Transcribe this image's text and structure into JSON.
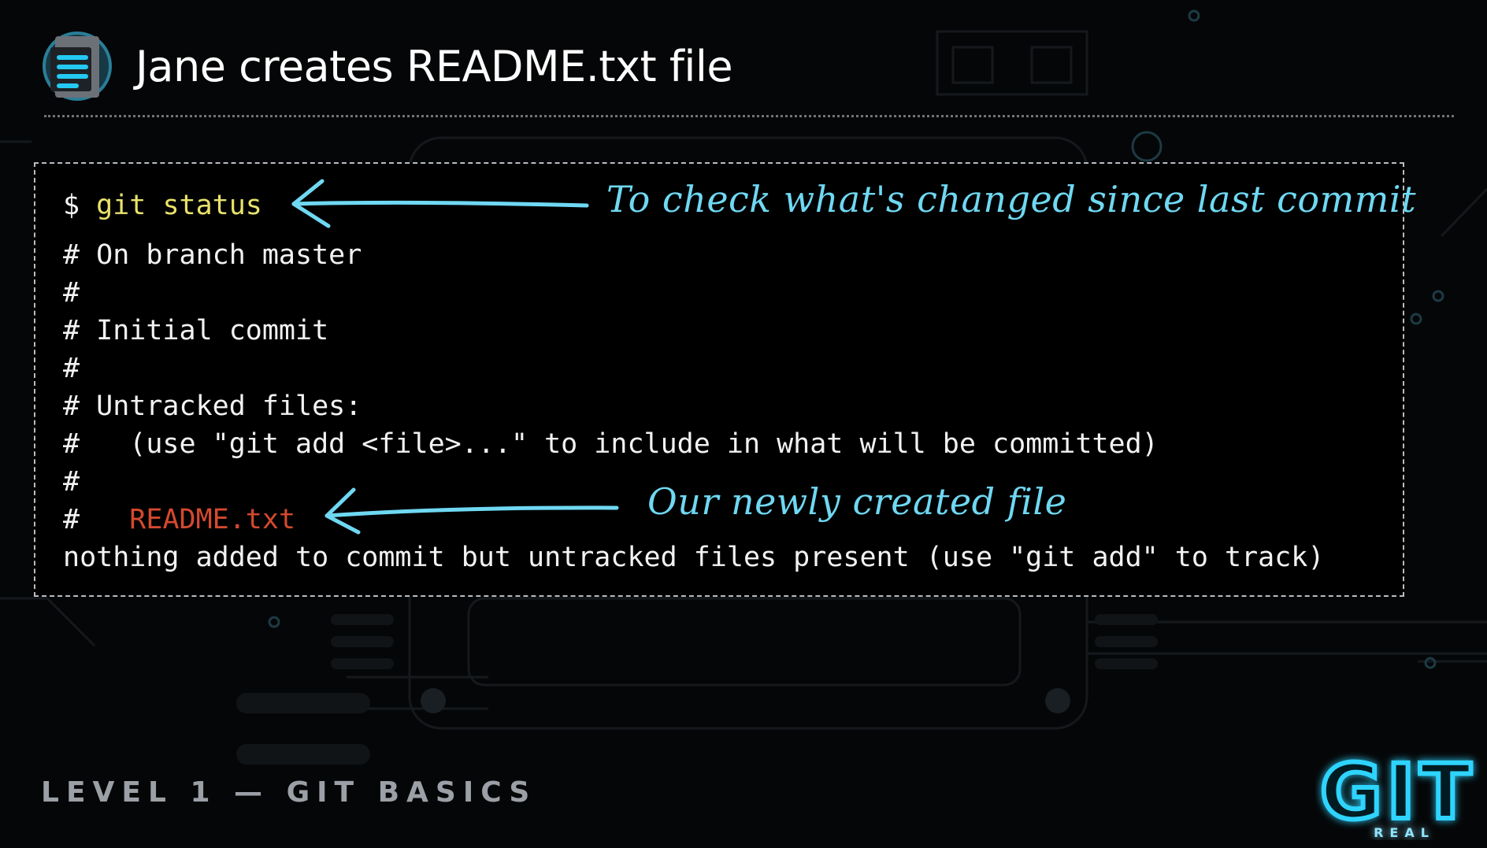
{
  "slide": {
    "title": "Jane creates README.txt file",
    "footer": "LEVEL 1 — GIT BASICS",
    "logo_text": "GIT",
    "logo_subtext": "REAL",
    "icon": "document-icon"
  },
  "terminal": {
    "prompt": "$ ",
    "command": "git status",
    "lines": [
      "# On branch master",
      "#",
      "# Initial commit",
      "#",
      "# Untracked files:",
      "#   (use \"git add <file>...\" to include in what will be committed)",
      "#",
      "#   ",
      "nothing added to commit but untracked files present (use \"git add\" to track)"
    ],
    "untracked_file": "README.txt"
  },
  "annotations": {
    "command_note": "To check what's changed since last commit",
    "file_note": "Our newly created file"
  },
  "colors": {
    "command": "#e8e26b",
    "untracked_file": "#d4492e",
    "annotation": "#6fd8f2",
    "logo_glow": "#20c8ff"
  }
}
